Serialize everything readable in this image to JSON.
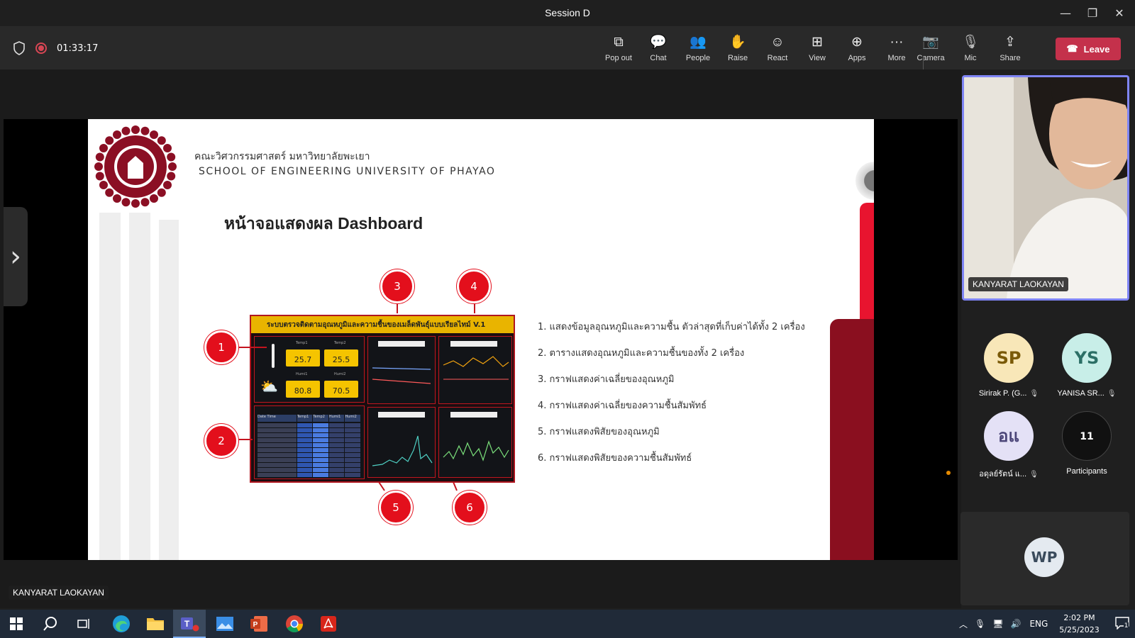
{
  "window": {
    "title": "Session D",
    "minimize": "—",
    "restore": "❐",
    "close": "✕"
  },
  "toolbar": {
    "timer": "01:33:17",
    "tools": [
      {
        "label": "Pop out",
        "icon": "pop-out-icon",
        "glyph": "⧉"
      },
      {
        "label": "Chat",
        "icon": "chat-icon",
        "glyph": "💬"
      },
      {
        "label": "People",
        "icon": "people-icon",
        "glyph": "👥"
      },
      {
        "label": "Raise",
        "icon": "raise-hand-icon",
        "glyph": "✋"
      },
      {
        "label": "React",
        "icon": "react-icon",
        "glyph": "☺"
      },
      {
        "label": "View",
        "icon": "view-icon",
        "glyph": "⊞"
      },
      {
        "label": "Apps",
        "icon": "apps-icon",
        "glyph": "⊕"
      },
      {
        "label": "More",
        "icon": "more-icon",
        "glyph": "···"
      },
      {
        "label": "Camera",
        "icon": "camera-off-icon",
        "glyph": "📷"
      },
      {
        "label": "Mic",
        "icon": "mic-off-icon",
        "glyph": "🎙"
      },
      {
        "label": "Share",
        "icon": "share-icon",
        "glyph": "⇪"
      }
    ],
    "leave_label": "Leave",
    "colors": {
      "leave": "#c4314b",
      "record": "#d74654",
      "active_tile": "#7f85f5"
    }
  },
  "slide": {
    "faculty_th": "คณะวิศวกรรมศาสตร์ มหาวิทยาลัยพะเยา",
    "faculty_en": "SCHOOL OF ENGINEERING UNIVERSITY OF PHAYAO",
    "title": "หน้าจอแสดงผล Dashboard",
    "dashboard_header": "ระบบตรวจติดตามอุณหภูมิและความชื้นของเมล็ดพันธุ์แบบเรียลไทม์ V.1",
    "cards": {
      "temp1": "25.7",
      "temp2": "25.5",
      "humi1": "80.8",
      "humi2": "70.5"
    },
    "card_captions": {
      "temp1": "Temp1",
      "temp2": "Temp2",
      "humi1": "Humi1",
      "humi2": "Humi2"
    },
    "table_headers": [
      "Date Time",
      "Temp1",
      "Temp2",
      "Humi1",
      "Humi2"
    ],
    "markers": [
      "1",
      "2",
      "3",
      "4",
      "5",
      "6"
    ],
    "legend": [
      "1. แสดงข้อมูลอุณหภูมิและความชื้น ตัวล่าสุดที่เก็บค่าได้ทั้ง 2 เครื่อง",
      "2. ตารางแสดงอุณหภูมิและความชื้นของทั้ง 2 เครื่อง",
      "3. กราฟแสดงค่าเฉลี่ยของอุณหภูมิ",
      "4. กราฟแสดงค่าเฉลี่ยของความชื้นสัมพัทธ์",
      "5. กราฟแสดงพิสัยของอุณหภูมิ",
      "6. กราฟแสดงพิสัยของความชื้นสัมพัทธ์"
    ]
  },
  "presenter": {
    "name": "KANYARAT LAOKAYAN"
  },
  "participants": [
    {
      "initials": "SP",
      "name": "Sirirak P. (G...",
      "bg": "#f8e7b8",
      "fg": "#7a5a08"
    },
    {
      "initials": "YS",
      "name": "YANISA SR...",
      "bg": "#c8eee8",
      "fg": "#2c6f66"
    },
    {
      "initials": "อแ",
      "name": "อดุลย์รัตน์ แ...",
      "bg": "#e4e1f6",
      "fg": "#4b4578"
    },
    {
      "initials": "11",
      "name": "Participants",
      "bg": "#111111",
      "fg": "#ffffff"
    }
  ],
  "bottom_tile": {
    "initials": "WP"
  },
  "taskbar": {
    "apps": [
      "start-icon",
      "search-icon",
      "task-view-icon",
      "edge-icon",
      "file-explorer-icon",
      "teams-icon",
      "photos-icon",
      "powerpoint-icon",
      "chrome-icon",
      "acrobat-icon"
    ],
    "language": "ENG",
    "time": "2:02 PM",
    "date": "5/25/2023",
    "notification_count": "1"
  }
}
